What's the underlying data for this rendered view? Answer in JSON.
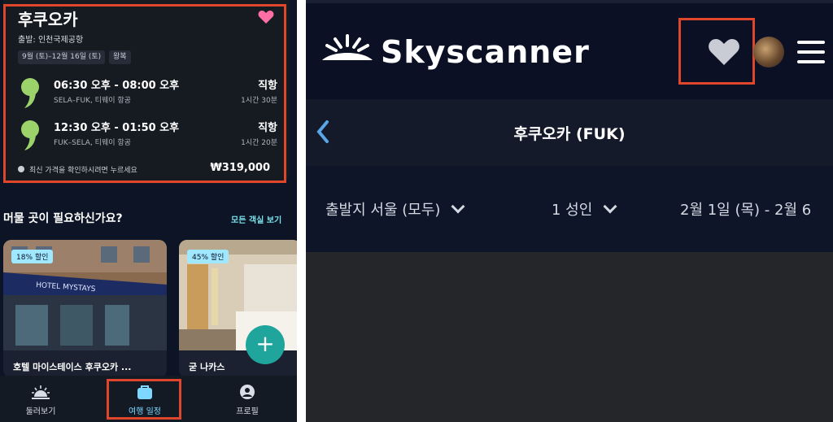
{
  "left": {
    "trip": {
      "city": "후쿠오카",
      "departure": "출발: 인천국제공항",
      "dates": "9월 (토)–12월 16일 (토)",
      "type": "왕복",
      "flights": [
        {
          "time": "06:30 오후 - 08:00 오후",
          "route": "SELA–FUK, 티웨이 항공",
          "stops": "직항",
          "duration": "1시간 30분"
        },
        {
          "time": "12:30 오후 - 01:50 오후",
          "route": "FUK–SELA, 티웨이 항공",
          "stops": "직항",
          "duration": "1시간 20분"
        }
      ],
      "note": "최신 가격을 확인하시려면 누르세요",
      "price": "₩319,000"
    },
    "stay": {
      "title": "머물 곳이 필요하신가요?",
      "see_all": "모든 객실 보기",
      "hotels": [
        {
          "badge": "18% 할인",
          "name": "호텔 마이스테이스 후쿠오카 ..."
        },
        {
          "badge": "45% 할인",
          "name": "굳 나카스"
        }
      ]
    },
    "fab_symbol": "+",
    "tabs": [
      {
        "label": "둘러보기",
        "icon": "sunrise-icon"
      },
      {
        "label": "여행 일정",
        "icon": "bag-icon"
      },
      {
        "label": "프로필",
        "icon": "profile-icon"
      }
    ],
    "colors": {
      "heart": "#ff6fa3",
      "accent": "#7dd7ff",
      "fab": "#1fa59b",
      "highlight": "#e0462c"
    }
  },
  "right": {
    "logo": "Skyscanner",
    "title": "후쿠오카 (FUK)",
    "filters": {
      "origin": "출발지 서울 (모두)",
      "travellers": "1 성인",
      "dates": "2월 1일 (목) - 2월 6"
    }
  }
}
